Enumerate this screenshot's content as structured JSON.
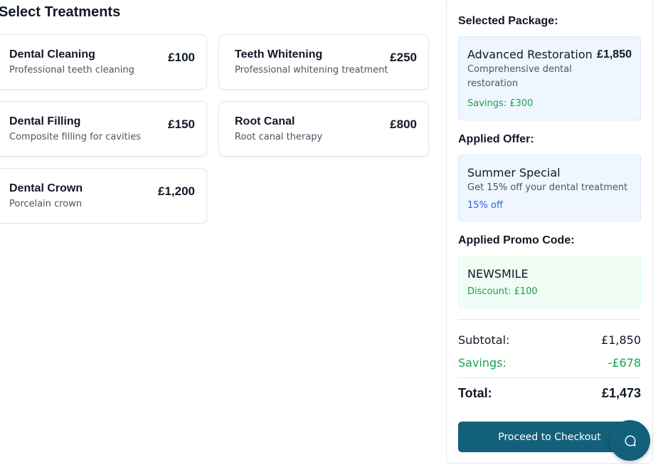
{
  "page_title": "Select Treatments",
  "treatments": [
    {
      "name": "Dental Cleaning",
      "description": "Professional teeth cleaning",
      "price": "£100"
    },
    {
      "name": "Teeth Whitening",
      "description": "Professional whitening treatment",
      "price": "£250"
    },
    {
      "name": "Dental Filling",
      "description": "Composite filling for cavities",
      "price": "£150"
    },
    {
      "name": "Root Canal",
      "description": "Root canal therapy",
      "price": "£800"
    },
    {
      "name": "Dental Crown",
      "description": "Porcelain crown",
      "price": "£1,200"
    }
  ],
  "summary": {
    "package_label": "Selected Package:",
    "package": {
      "name": "Advanced Restoration",
      "price": "£1,850",
      "description_line1": "Comprehensive dental",
      "description_line2": "restoration",
      "savings": "Savings: £300"
    },
    "offer_label": "Applied Offer:",
    "offer": {
      "name": "Summer Special",
      "description": "Get 15% off your dental treatment",
      "discount": "15% off"
    },
    "promo_label": "Applied Promo Code:",
    "promo": {
      "code": "NEWSMILE",
      "discount": "Discount: £100"
    },
    "subtotal_label": "Subtotal:",
    "subtotal_value": "£1,850",
    "savings_label": "Savings:",
    "savings_value": "-£678",
    "total_label": "Total:",
    "total_value": "£1,473",
    "checkout_label": "Proceed to Checkout"
  },
  "colors": {
    "primary": "#13607a",
    "savings_green": "#16a34a",
    "offer_blue": "#2563eb"
  },
  "icons": {
    "chat": "chat-bubble-icon"
  }
}
